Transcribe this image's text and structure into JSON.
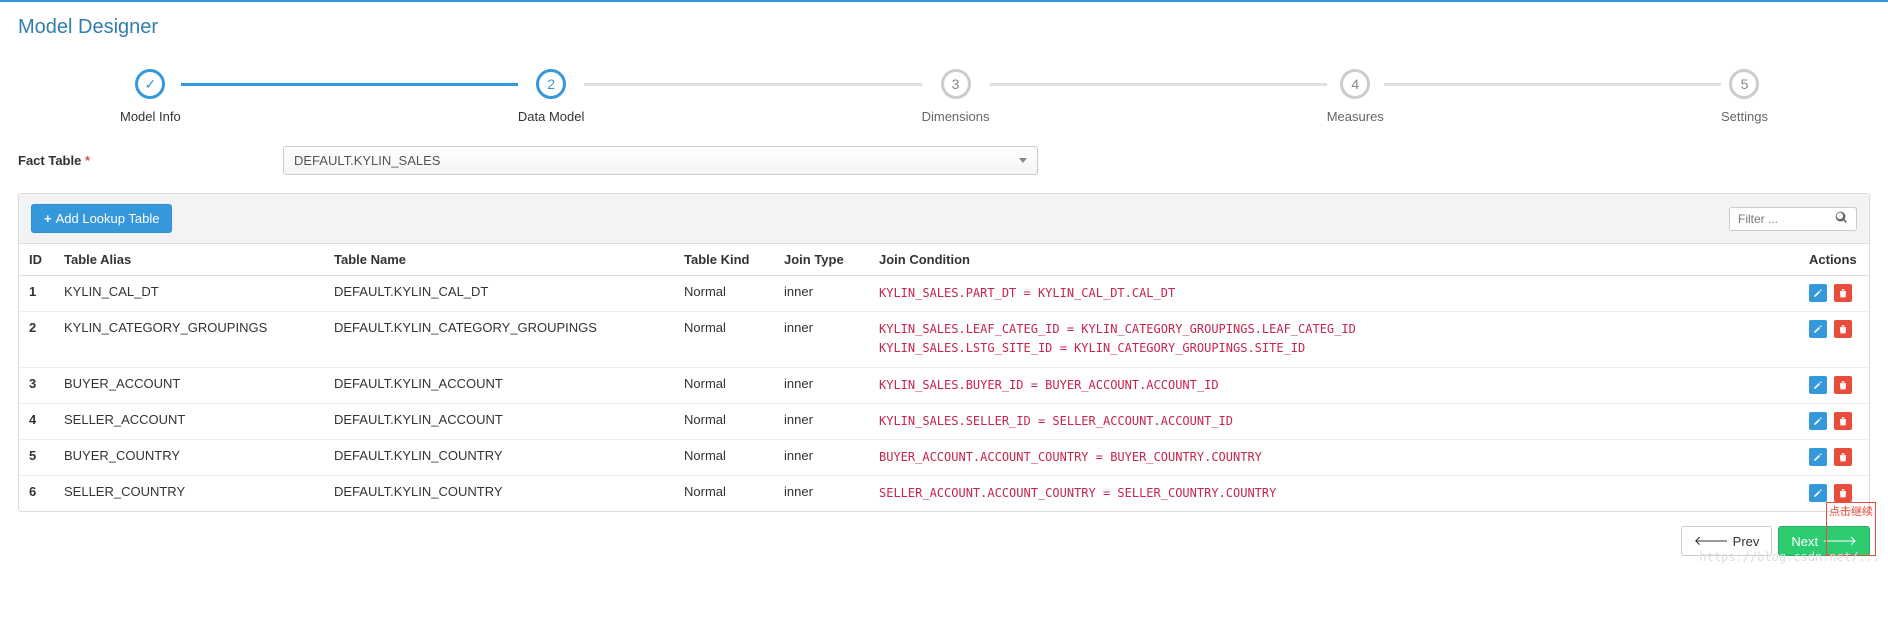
{
  "page_title": "Model Designer",
  "stepper": {
    "steps": [
      {
        "label": "Model Info",
        "marker": "✓",
        "state": "done"
      },
      {
        "label": "Data Model",
        "marker": "2",
        "state": "active"
      },
      {
        "label": "Dimensions",
        "marker": "3",
        "state": "pending"
      },
      {
        "label": "Measures",
        "marker": "4",
        "state": "pending"
      },
      {
        "label": "Settings",
        "marker": "5",
        "state": "pending"
      }
    ]
  },
  "fact_table": {
    "label": "Fact Table",
    "value": "DEFAULT.KYLIN_SALES"
  },
  "panel": {
    "add_button": "Add Lookup Table",
    "filter_placeholder": "Filter ..."
  },
  "columns": {
    "id": "ID",
    "alias": "Table Alias",
    "name": "Table Name",
    "kind": "Table Kind",
    "join": "Join Type",
    "condition": "Join Condition",
    "actions": "Actions"
  },
  "rows": [
    {
      "id": "1",
      "alias": "KYLIN_CAL_DT",
      "name": "DEFAULT.KYLIN_CAL_DT",
      "kind": "Normal",
      "join": "inner",
      "condition": "KYLIN_SALES.PART_DT = KYLIN_CAL_DT.CAL_DT"
    },
    {
      "id": "2",
      "alias": "KYLIN_CATEGORY_GROUPINGS",
      "name": "DEFAULT.KYLIN_CATEGORY_GROUPINGS",
      "kind": "Normal",
      "join": "inner",
      "condition": "KYLIN_SALES.LEAF_CATEG_ID = KYLIN_CATEGORY_GROUPINGS.LEAF_CATEG_ID\nKYLIN_SALES.LSTG_SITE_ID = KYLIN_CATEGORY_GROUPINGS.SITE_ID"
    },
    {
      "id": "3",
      "alias": "BUYER_ACCOUNT",
      "name": "DEFAULT.KYLIN_ACCOUNT",
      "kind": "Normal",
      "join": "inner",
      "condition": "KYLIN_SALES.BUYER_ID = BUYER_ACCOUNT.ACCOUNT_ID"
    },
    {
      "id": "4",
      "alias": "SELLER_ACCOUNT",
      "name": "DEFAULT.KYLIN_ACCOUNT",
      "kind": "Normal",
      "join": "inner",
      "condition": "KYLIN_SALES.SELLER_ID = SELLER_ACCOUNT.ACCOUNT_ID"
    },
    {
      "id": "5",
      "alias": "BUYER_COUNTRY",
      "name": "DEFAULT.KYLIN_COUNTRY",
      "kind": "Normal",
      "join": "inner",
      "condition": "BUYER_ACCOUNT.ACCOUNT_COUNTRY = BUYER_COUNTRY.COUNTRY"
    },
    {
      "id": "6",
      "alias": "SELLER_COUNTRY",
      "name": "DEFAULT.KYLIN_COUNTRY",
      "kind": "Normal",
      "join": "inner",
      "condition": "SELLER_ACCOUNT.ACCOUNT_COUNTRY = SELLER_COUNTRY.COUNTRY"
    }
  ],
  "footer": {
    "prev": "Prev",
    "next": "Next",
    "annotation": "点击继续"
  },
  "watermark": "https://blog.csdn.net/..."
}
